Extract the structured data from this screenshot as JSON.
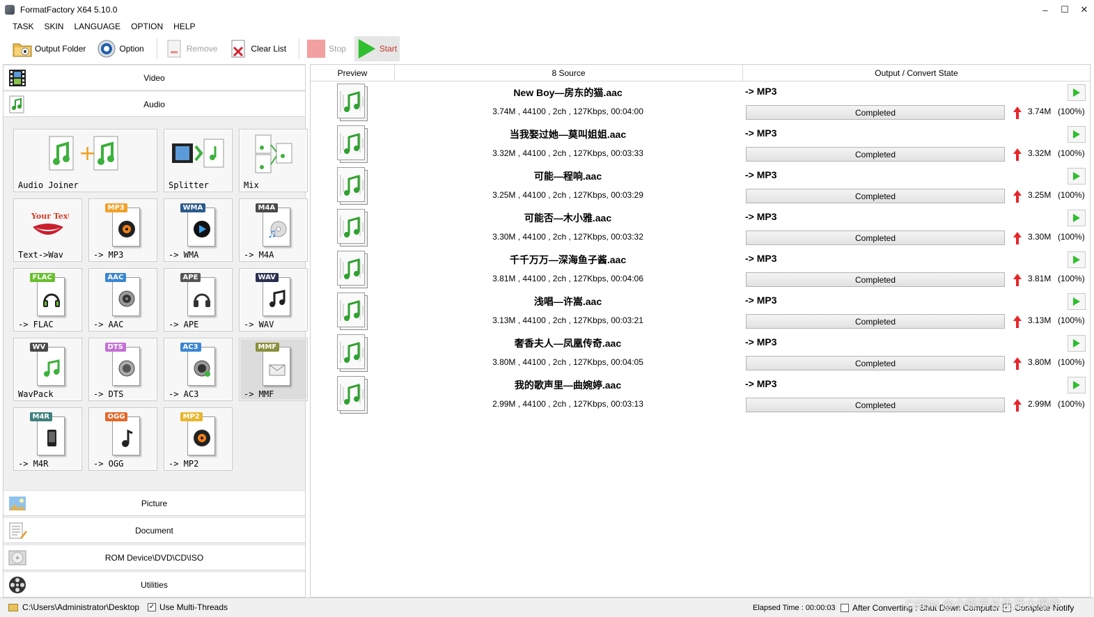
{
  "window": {
    "title": "FormatFactory X64 5.10.0",
    "minimize": "–",
    "maximize": "☐",
    "close": "✕"
  },
  "menu": [
    "TASK",
    "SKIN",
    "LANGUAGE",
    "OPTION",
    "HELP"
  ],
  "toolbar": {
    "output_folder": "Output Folder",
    "option": "Option",
    "remove": "Remove",
    "clear_list": "Clear List",
    "stop": "Stop",
    "start": "Start"
  },
  "categories": {
    "video": "Video",
    "audio": "Audio",
    "picture": "Picture",
    "document": "Document",
    "rom": "ROM Device\\DVD\\CD\\ISO",
    "utilities": "Utilities"
  },
  "audio_tools": {
    "joiner": "Audio Joiner",
    "splitter": "Splitter",
    "mix": "Mix",
    "formats": [
      {
        "label": "Text->Wav",
        "tag": "",
        "color": "#cc3b2c",
        "glyph": ""
      },
      {
        "label": "-> MP3",
        "tag": "MP3",
        "color": "#f0a22b",
        "glyph": "◉"
      },
      {
        "label": "-> WMA",
        "tag": "WMA",
        "color": "#2a5a8c",
        "glyph": "◉"
      },
      {
        "label": "-> M4A",
        "tag": "M4A",
        "color": "#4a4a4a",
        "glyph": "♫"
      },
      {
        "label": "-> FLAC",
        "tag": "FLAC",
        "color": "#6abf2f",
        "glyph": "🎧"
      },
      {
        "label": "-> AAC",
        "tag": "AAC",
        "color": "#3a86d4",
        "glyph": "🔊"
      },
      {
        "label": "-> APE",
        "tag": "APE",
        "color": "#555555",
        "glyph": "🎧"
      },
      {
        "label": "-> WAV",
        "tag": "WAV",
        "color": "#2b2f4f",
        "glyph": "♫"
      },
      {
        "label": "WavPack",
        "tag": "WV",
        "color": "#4a4a4a",
        "glyph": "♫"
      },
      {
        "label": "-> DTS",
        "tag": "DTS",
        "color": "#c46fd6",
        "glyph": "🔊"
      },
      {
        "label": "-> AC3",
        "tag": "AC3",
        "color": "#3a86d4",
        "glyph": "🔊"
      },
      {
        "label": "-> MMF",
        "tag": "MMF",
        "color": "#8a8f3a",
        "glyph": "✉"
      },
      {
        "label": "-> M4R",
        "tag": "M4R",
        "color": "#3f7f7f",
        "glyph": "▮"
      },
      {
        "label": "-> OGG",
        "tag": "OGG",
        "color": "#e2692a",
        "glyph": "♪"
      },
      {
        "label": "-> MP2",
        "tag": "MP2",
        "color": "#e8b52c",
        "glyph": "◉"
      }
    ]
  },
  "list": {
    "headers": {
      "preview": "Preview",
      "source": "8 Source",
      "output": "Output / Convert State"
    },
    "rows": [
      {
        "name": "New Boy—房东的猫.aac",
        "info": "3.74M , 44100 , 2ch , 127Kbps, 00:04:00",
        "format": "-> MP3",
        "state": "Completed",
        "size": "3.74M",
        "pct": "(100%)"
      },
      {
        "name": "当我娶过她—莫叫姐姐.aac",
        "info": "3.32M , 44100 , 2ch , 127Kbps, 00:03:33",
        "format": "-> MP3",
        "state": "Completed",
        "size": "3.32M",
        "pct": "(100%)"
      },
      {
        "name": "可能—程响.aac",
        "info": "3.25M , 44100 , 2ch , 127Kbps, 00:03:29",
        "format": "-> MP3",
        "state": "Completed",
        "size": "3.25M",
        "pct": "(100%)"
      },
      {
        "name": "可能否—木小雅.aac",
        "info": "3.30M , 44100 , 2ch , 127Kbps, 00:03:32",
        "format": "-> MP3",
        "state": "Completed",
        "size": "3.30M",
        "pct": "(100%)"
      },
      {
        "name": "千千万万—深海鱼子酱.aac",
        "info": "3.81M , 44100 , 2ch , 127Kbps, 00:04:06",
        "format": "-> MP3",
        "state": "Completed",
        "size": "3.81M",
        "pct": "(100%)"
      },
      {
        "name": "浅唱—许嵩.aac",
        "info": "3.13M , 44100 , 2ch , 127Kbps, 00:03:21",
        "format": "-> MP3",
        "state": "Completed",
        "size": "3.13M",
        "pct": "(100%)"
      },
      {
        "name": "奢香夫人—凤凰传奇.aac",
        "info": "3.80M , 44100 , 2ch , 127Kbps, 00:04:05",
        "format": "-> MP3",
        "state": "Completed",
        "size": "3.80M",
        "pct": "(100%)"
      },
      {
        "name": "我的歌声里—曲婉婷.aac",
        "info": "2.99M , 44100 , 2ch , 127Kbps, 00:03:13",
        "format": "-> MP3",
        "state": "Completed",
        "size": "2.99M",
        "pct": "(100%)"
      }
    ]
  },
  "status": {
    "path": "C:\\Users\\Administrator\\Desktop",
    "multi_threads": "Use Multi-Threads",
    "elapsed": "Elapsed Time : 00:00:03",
    "after_converting": "After Converting : Shut Down Computer",
    "complete_notify": "Complete Notify",
    "watermark": "CSDN @小锋学长生活大爆炸"
  },
  "colors": {
    "accent_green": "#2fbf2f",
    "arrow_red": "#e8262a",
    "stop_red": "#f2a0a0"
  }
}
